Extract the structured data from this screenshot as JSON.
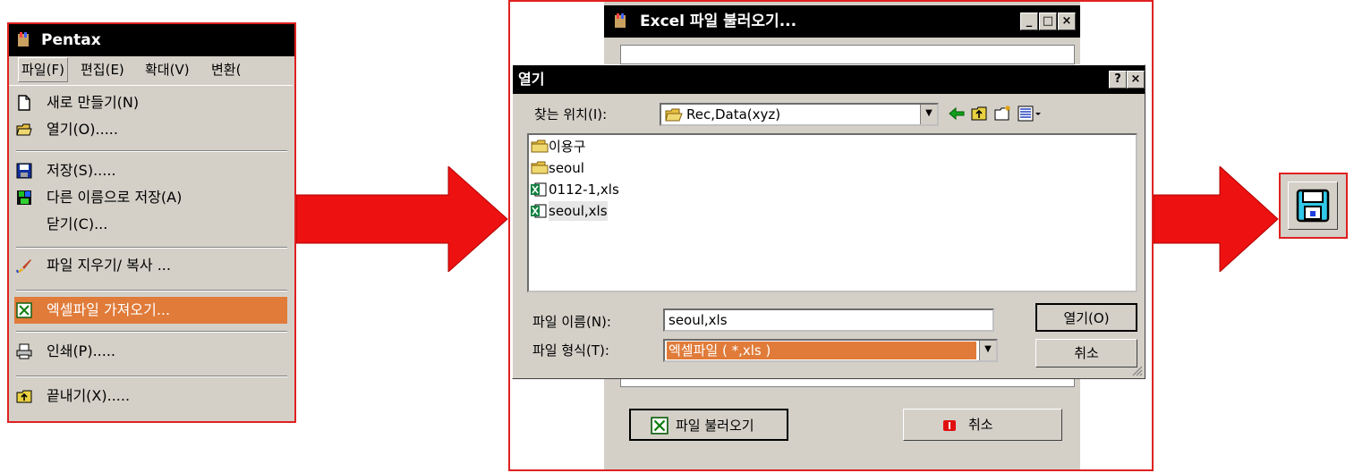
{
  "menu_window": {
    "title": "Pentax",
    "menubar": [
      "파일(F)",
      "편집(E)",
      "확대(V)",
      "변환("
    ],
    "items": [
      {
        "label": "새로 만들기(N)",
        "icon": "new-file-icon"
      },
      {
        "label": "열기(O).....",
        "icon": "open-folder-icon"
      },
      {
        "label": "저장(S).....",
        "icon": "save-disk-icon"
      },
      {
        "label": "다른 이름으로 저장(A)",
        "icon": "save-as-icon"
      },
      {
        "label": "닫기(C)...",
        "icon": ""
      },
      {
        "label": "파일 지우기/ 복사 ...",
        "icon": "brush-icon"
      },
      {
        "label": "엑셀파일 가져오기...",
        "icon": "excel-import-icon",
        "highlighted": true
      },
      {
        "label": "인쇄(P).....",
        "icon": "printer-icon"
      },
      {
        "label": "끝내기(X).....",
        "icon": "exit-icon"
      }
    ]
  },
  "excel_window": {
    "title": "Excel 파일 불러오기...",
    "controls": [
      "_",
      "□",
      "×"
    ],
    "load_button": "파일 불러오기",
    "cancel_button": "취소"
  },
  "open_dialog": {
    "title": "열기",
    "help_btn": "?",
    "close_btn": "×",
    "look_in_label": "찾는 위치(I):",
    "look_in_value": "Rec,Data(xyz)",
    "files": [
      {
        "name": "이용구",
        "type": "folder"
      },
      {
        "name": "seoul",
        "type": "folder"
      },
      {
        "name": "0112-1,xls",
        "type": "excel"
      },
      {
        "name": "seoul,xls",
        "type": "excel",
        "selected": true
      }
    ],
    "filename_label": "파일 이름(N):",
    "filename_value": "seoul,xls",
    "filetype_label": "파일 형식(T):",
    "filetype_value": "엑셀파일 ( *,xls )",
    "open_button": "열기(O)",
    "cancel_button": "취소"
  },
  "colors": {
    "frame_red": "#e02020",
    "arrow_red": "#ee1111",
    "highlight_orange": "#e07b39",
    "win_gray": "#d4d0c8",
    "title_black": "#000000"
  }
}
